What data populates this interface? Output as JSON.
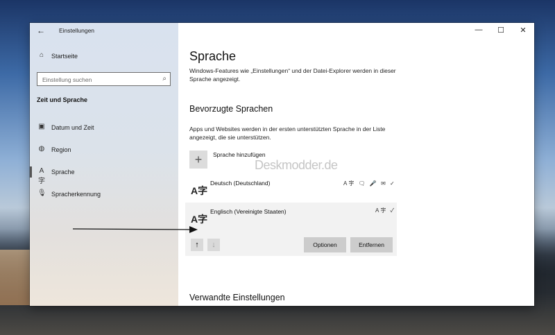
{
  "window": {
    "title": "Einstellungen"
  },
  "sidebar": {
    "home": "Startseite",
    "search_placeholder": "Einstellung suchen",
    "section": "Zeit und Sprache",
    "items": [
      {
        "label": "Datum und Zeit",
        "icon": "calendar-clock-icon"
      },
      {
        "label": "Region",
        "icon": "globe-icon"
      },
      {
        "label": "Sprache",
        "icon": "language-icon",
        "active": true
      },
      {
        "label": "Spracherkennung",
        "icon": "microphone-icon"
      }
    ]
  },
  "main": {
    "title": "Sprache",
    "description": "Windows-Features wie „Einstellungen“ und der Datei-Explorer werden in dieser Sprache angezeigt.",
    "preferred_heading": "Bevorzugte Sprachen",
    "preferred_description": "Apps und Websites werden in der ersten unterstützten Sprache in der Liste angezeigt, die sie unterstützen.",
    "add_language": "Sprache hinzufügen",
    "languages": [
      {
        "name": "Deutsch (Deutschland)",
        "features": "A字 🗨 🎤 ✉ ✓"
      },
      {
        "name": "Englisch (Vereinigte Staaten)",
        "features": "A字 ✓",
        "selected": true
      }
    ],
    "options_button": "Optionen",
    "remove_button": "Entfernen",
    "related_heading": "Verwandte Einstellungen"
  },
  "watermark": "Deskmodder.de"
}
